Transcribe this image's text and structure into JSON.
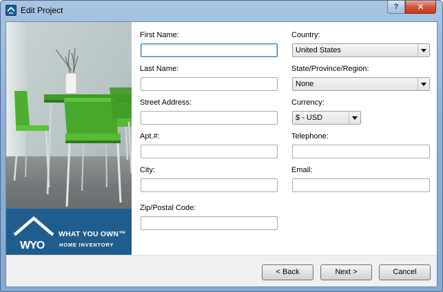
{
  "window": {
    "title": "Edit Project",
    "help_label": "?",
    "close_label": "✕",
    "app_icon": "wyo-house-icon"
  },
  "brand": {
    "logo_text": "WYO",
    "name": "WHAT YOU OWN™",
    "subtitle": "HOME INVENTORY"
  },
  "form": {
    "first_name": {
      "label": "First Name:",
      "value": ""
    },
    "last_name": {
      "label": "Last Name:",
      "value": ""
    },
    "street_address": {
      "label": "Street Address:",
      "value": ""
    },
    "apt": {
      "label": "Apt.#:",
      "value": ""
    },
    "city": {
      "label": "City:",
      "value": ""
    },
    "zip": {
      "label": "Zip/Postal Code:",
      "value": ""
    },
    "country": {
      "label": "Country:",
      "value": "United States"
    },
    "state": {
      "label": "State/Province/Region:",
      "value": "None"
    },
    "currency": {
      "label": "Currency:",
      "value": "$ - USD"
    },
    "telephone": {
      "label": "Telephone:",
      "value": ""
    },
    "email": {
      "label": "Email:",
      "value": ""
    }
  },
  "buttons": {
    "back": "< Back",
    "next": "Next >",
    "cancel": "Cancel"
  },
  "colors": {
    "brand_blue": "#1f5d8e",
    "focus_border": "#3c7fb1",
    "close_red": "#d5543b"
  }
}
